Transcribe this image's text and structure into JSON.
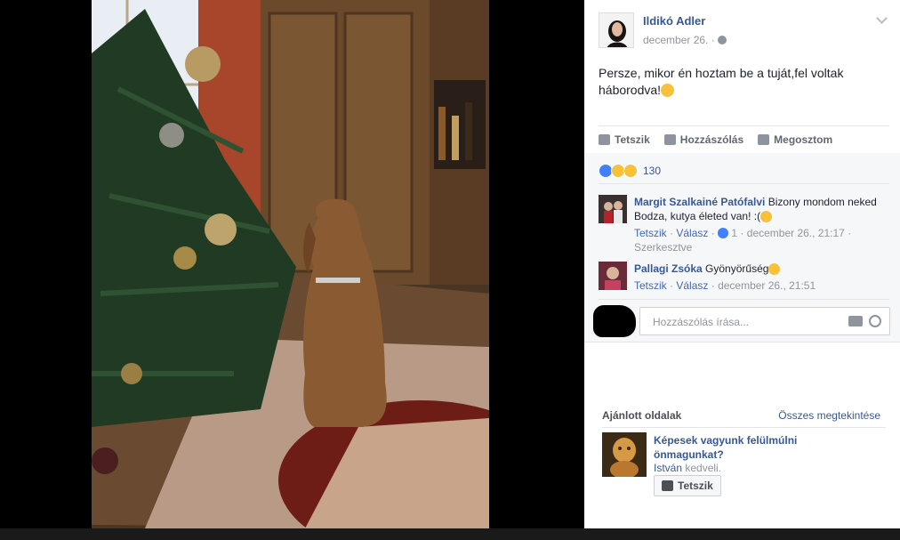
{
  "post": {
    "author": "Ildikó Adler",
    "date": "december 26. ·",
    "text": "Persze, mikor én hoztam be a tuját,fel voltak háborodva!",
    "actions": {
      "like": "Tetszik",
      "comment": "Hozzászólás",
      "share": "Megosztom"
    },
    "reaction_count": "130"
  },
  "comments": [
    {
      "name": "Margit Szalkainé Patófalvi",
      "text": "Bizony mondom neked Bodza, kutya életed van! :(",
      "like": "Tetszik",
      "reply": "Válasz",
      "likes": "1",
      "meta": "december 26., 21:17 ·",
      "edited": "Szerkesztve"
    },
    {
      "name": "Pallagi Zsóka",
      "text": "Gyönyörűség",
      "like": "Tetszik",
      "reply": "Válasz",
      "meta": "december 26., 21:51"
    }
  ],
  "write_comment": {
    "placeholder": "Hozzászólás írása..."
  },
  "recommended": {
    "title": "Ajánlott oldalak",
    "see_all": "Összes megtekintése",
    "page_name": "Képesek vagyunk felülmúlni önmagunkat?",
    "liked_by_name": "István",
    "liked_by_suffix": "kedveli.",
    "like_button": "Tetszik"
  },
  "icons": [
    "globe-icon",
    "chevron-down-icon",
    "like-icon",
    "comment-icon",
    "share-icon",
    "camera-icon",
    "emoji-icon"
  ],
  "colors": {
    "link": "#365899",
    "accent": "#4267b2",
    "muted": "#90949c",
    "panel_bg": "#ffffff",
    "comments_bg": "#f6f7f9"
  }
}
